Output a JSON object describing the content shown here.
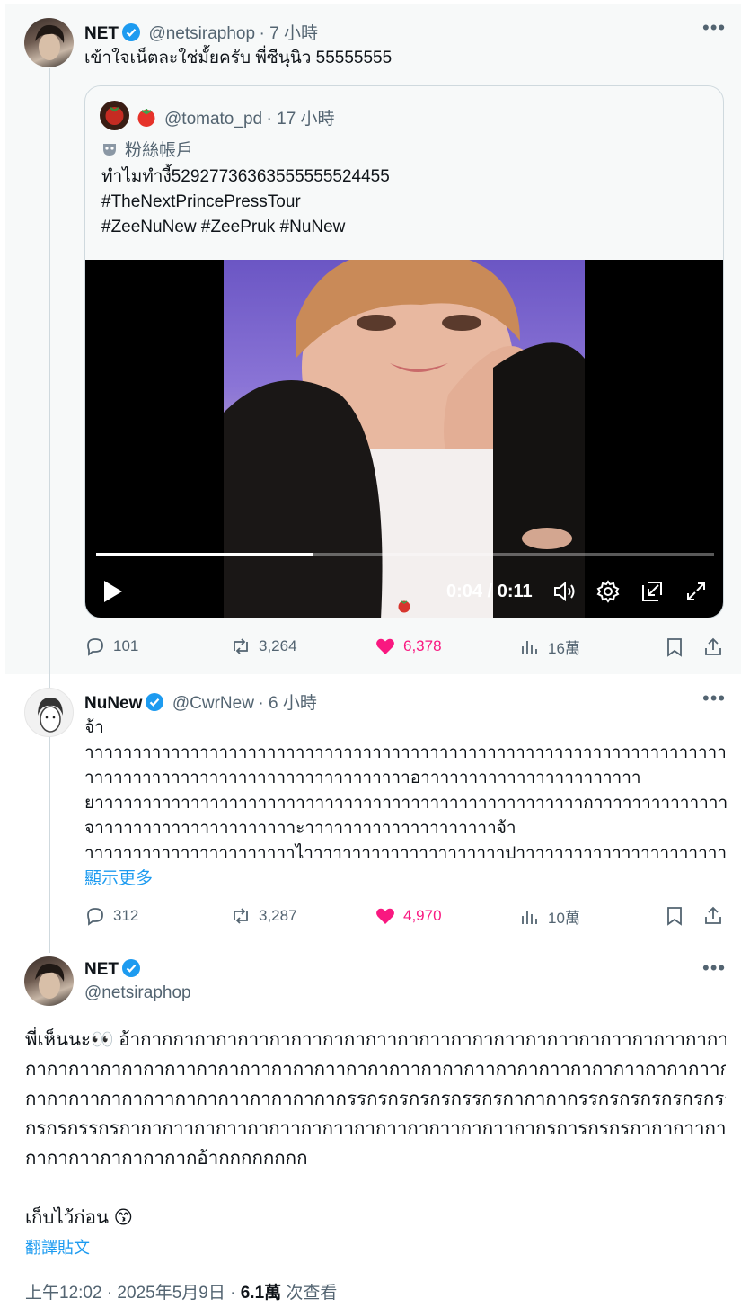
{
  "tweet1": {
    "name": "NET",
    "handle": "@netsiraphop",
    "time": "· 7 小時",
    "text": "เข้าใจเน็ตละใช่มั้ยครับ พี่ซีนุนิว 55555555",
    "quote": {
      "handle": "@tomato_pd",
      "time": "· 17 小時",
      "fan_badge": "粉絲帳戶",
      "lines": [
        "ทำไมทำงี้52927736363555555524455",
        "#TheNextPrincePressTour",
        "#ZeeNuNew #ZeePruk #NuNew"
      ],
      "video": {
        "time": "0:04 / 0:11",
        "progress": 0.35
      }
    },
    "stats": {
      "replies": "101",
      "retweets": "3,264",
      "likes": "6,378",
      "views": "16萬"
    }
  },
  "tweet2": {
    "name": "NuNew",
    "handle": "@CwrNew",
    "time": "· 6 小時",
    "lines": [
      "จ้า",
      "าาาาาาาาาาาาาาาาาาาาาาาาาาาาาาาาาาาาาาาาาาาาาาาาาาาาาาาาาาาาาาาาาาาาาาาาาาาาาาาาาาาาา",
      "าาาาาาาาาาาาาาาาาาาาาาาาาาาาาาาาาาอาาาาาาาาาาาาาาาาาาาาาาา",
      "ยาาาาาาาาาาาาาาาาาาาาาาาาาาาาาาาาาาาาาาาาาาาาาาาาาาากาาาาาาาาาาาาาาาาาา",
      "จาาาาาาาาาาาาาาาาาาาาาะาาาาาาาาาาาาาาาาาาาาจ้า",
      "าาาาาาาาาาาาาาาาาาาาาาไาาาาาาาาาาาาาาาาาาาาาปาาาาาาาาาาาาาาาาาาาาาาาาาาาาถ้า"
    ],
    "show_more": "顯示更多",
    "stats": {
      "replies": "312",
      "retweets": "3,287",
      "likes": "4,970",
      "views": "10萬"
    }
  },
  "main": {
    "name": "NET",
    "handle": "@netsiraphop",
    "lines": [
      "พี่เห็นนะ👀 อ้ากากกากากากาากากาากากากาากากาากากากาากากาากากาากากาากากากาากากา",
      "กากากาากากากากาากากากาากากากาากากากาากากากาากากากาากากากาากากากาากากาากากา",
      "กากากาากากากาากากากาากากากากากรรกรกรกรกรกรรกรกากากากรรกรกรกรกรกรกรร",
      "กรกรกรรกรกากากาากากาากากาากากาากากาากากาากากาากากรการกรกรกากากาากากา",
      "กากากาากากากากากอ้ากกกกกกกก"
    ],
    "closing": "เก็บไว้ก่อน 😙",
    "translate": "翻譯貼文",
    "meta_time": "上午12:02 · 2025年5月9日 ·",
    "meta_views": "6.1萬",
    "meta_views_label": " 次查看"
  },
  "colors": {
    "blue": "#1d9bf0",
    "pink": "#f91880",
    "muted": "#536471",
    "border": "#cfd9de"
  }
}
